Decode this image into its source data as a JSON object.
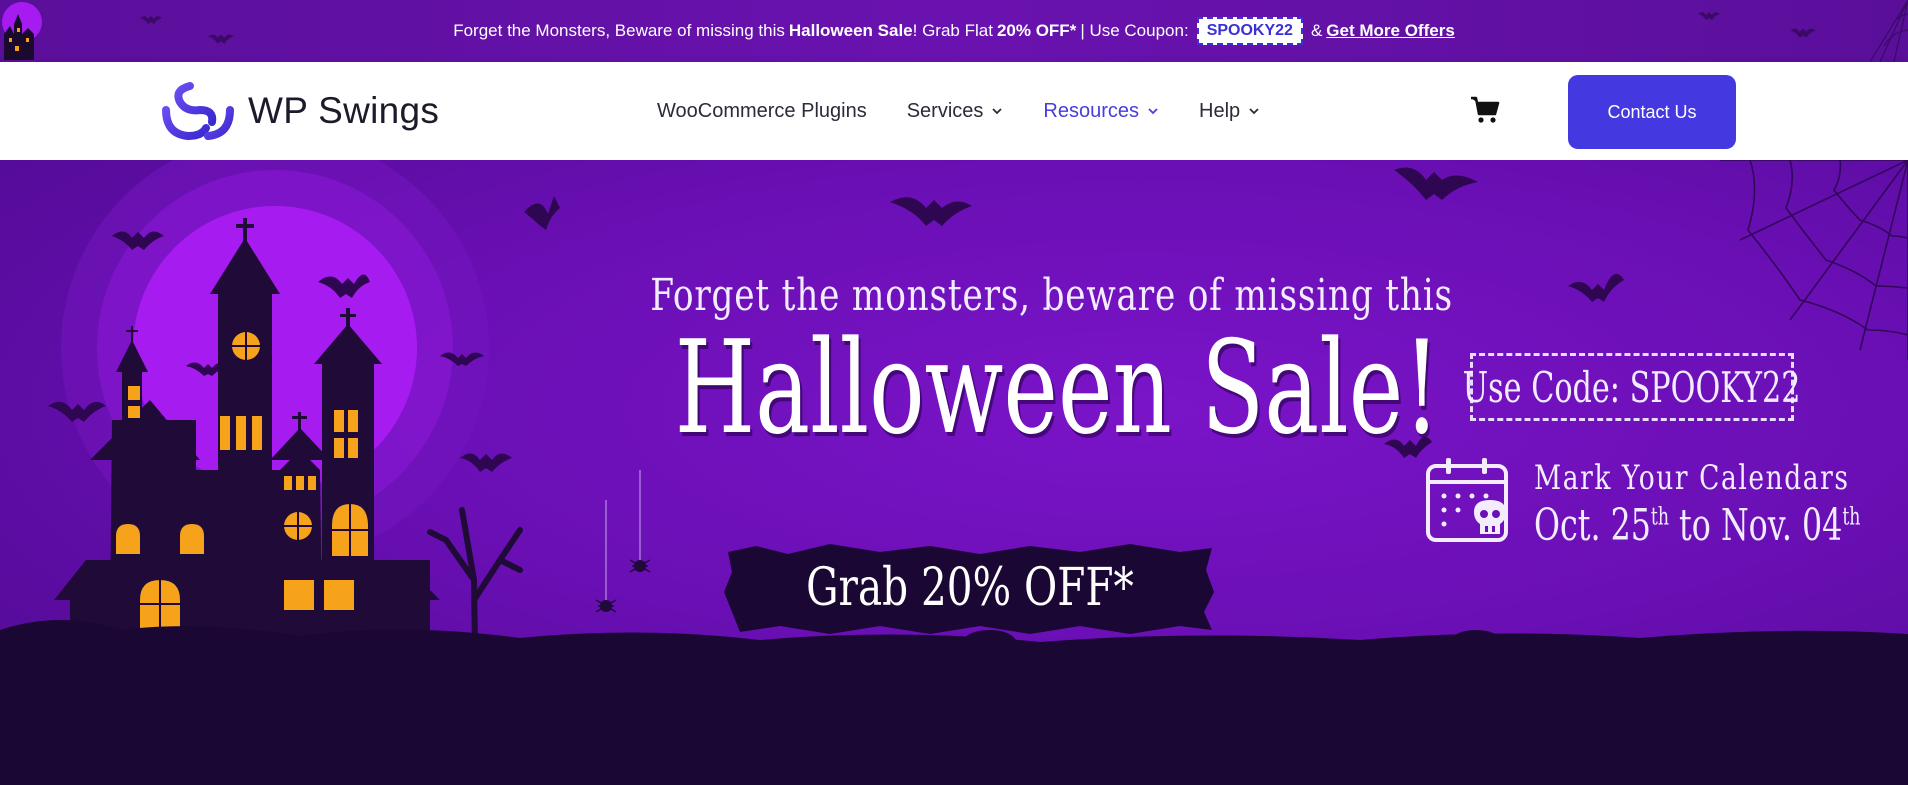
{
  "promo": {
    "text_start": "Forget the Monsters, Beware of missing this",
    "sale_name": "Halloween Sale",
    "text_mid": "! Grab Flat",
    "discount": "20% OFF*",
    "text_coupon": "| Use Coupon:",
    "coupon_code": "SPOOKY22",
    "amp": "&",
    "offers_link": "Get More Offers"
  },
  "header": {
    "logo_text": "WP Swings",
    "nav": [
      {
        "label": "WooCommerce Plugins",
        "has_dropdown": false
      },
      {
        "label": "Services",
        "has_dropdown": true
      },
      {
        "label": "Resources",
        "has_dropdown": true,
        "active": true
      },
      {
        "label": "Help",
        "has_dropdown": true
      }
    ],
    "cart_icon": "shopping-cart-icon",
    "contact_label": "Contact Us"
  },
  "hero": {
    "tagline": "Forget the monsters, beware of missing this",
    "title": "Halloween Sale!",
    "grab": "Grab 20% OFF*",
    "code_label": "Use Code: SPOOKY22",
    "calendar_title": "Mark Your Calendars",
    "date_start": "Oct. 25",
    "date_start_suffix": "th",
    "date_to": "to",
    "date_end": "Nov. 04",
    "date_end_suffix": "th"
  },
  "colors": {
    "accent": "#4438e0",
    "active_nav": "#4a3ddc",
    "promo_bg": "#6a12b0",
    "hero_bg": "#6a0fb5",
    "moon": "#a61cf0",
    "window": "#f7a21b"
  }
}
